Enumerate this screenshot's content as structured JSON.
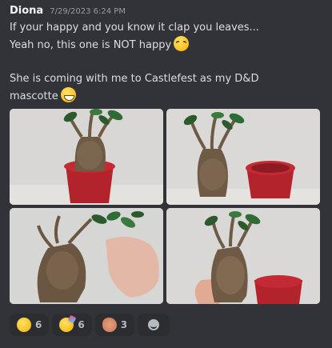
{
  "message": {
    "author": "Diona",
    "timestamp": "7/29/2023 6:24 PM",
    "line1": "If your happy and you know it clap you leaves...",
    "line2": "Yeah no, this one is NOT happy",
    "line3": "She is coming with me to Castlefest as my D&D",
    "line4": "mascotte",
    "line2_emoji": "rolling-on-floor-laughing-emoji",
    "line4_emoji": "grinning-face-emoji"
  },
  "attachments": [
    {
      "name": "mandrake-photo-1"
    },
    {
      "name": "mandrake-photo-2"
    },
    {
      "name": "mandrake-photo-3"
    },
    {
      "name": "mandrake-photo-4"
    }
  ],
  "reactions": [
    {
      "emoji": "rolling-on-floor-laughing-emoji",
      "count": "6"
    },
    {
      "emoji": "partying-face-emoji",
      "count": "6"
    },
    {
      "emoji": "clapping-hands-emoji",
      "count": "3"
    }
  ],
  "add_reaction_icon": "smile-plus-icon",
  "colors": {
    "background": "#313338",
    "reaction_bg": "#2b2d31",
    "text": "#dbdee1",
    "timestamp": "#949ba4"
  }
}
